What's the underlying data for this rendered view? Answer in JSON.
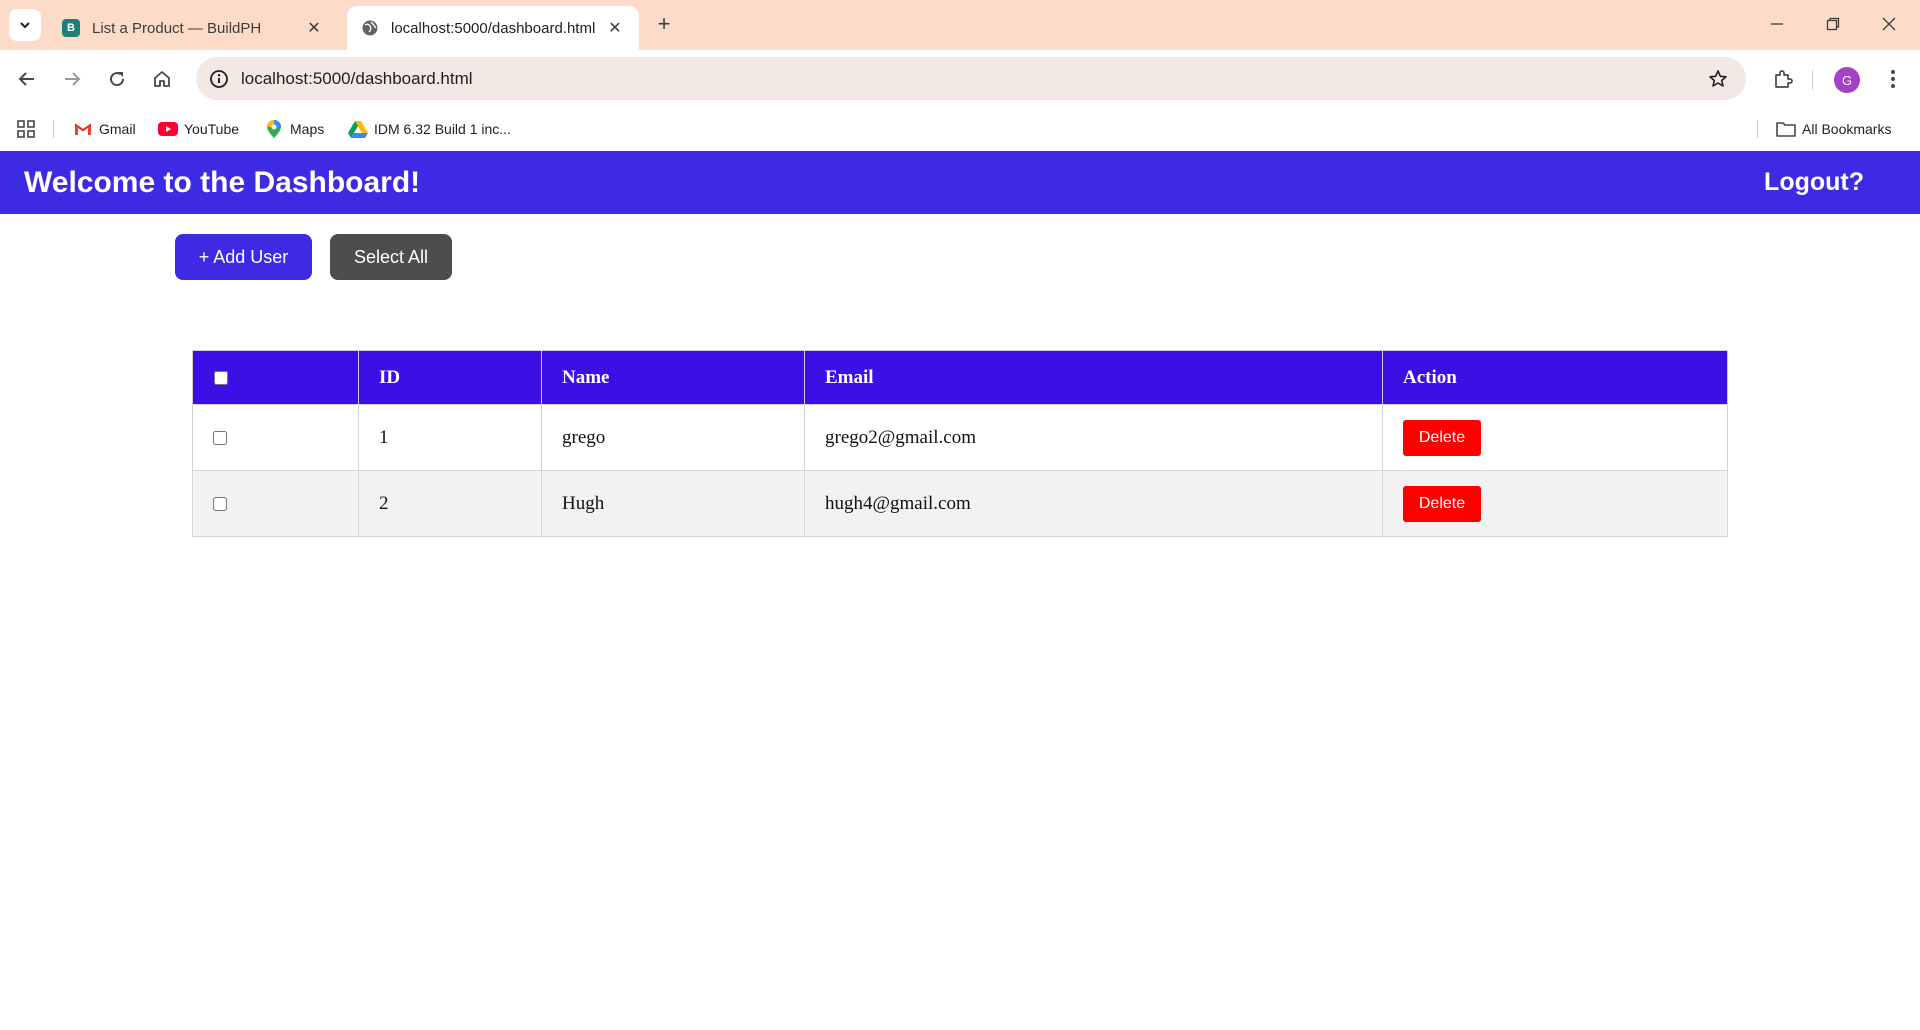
{
  "browser": {
    "tabs": [
      {
        "label": "List a Product — BuildPH",
        "favicon_letter": "B",
        "active": false
      },
      {
        "label": "localhost:5000/dashboard.html",
        "active": true
      }
    ],
    "address": "localhost:5000/dashboard.html",
    "profile_initial": "G",
    "bookmarks": [
      {
        "label": "Gmail",
        "icon": "gmail-icon"
      },
      {
        "label": "YouTube",
        "icon": "youtube-icon"
      },
      {
        "label": "Maps",
        "icon": "maps-icon"
      },
      {
        "label": "IDM 6.32 Build 1 inc...",
        "icon": "drive-icon"
      }
    ],
    "all_bookmarks_label": "All Bookmarks"
  },
  "header": {
    "title": "Welcome to the Dashboard!",
    "logout_label": "Logout?"
  },
  "actions": {
    "add_user_label": "+ Add User",
    "select_all_label": "Select All"
  },
  "table": {
    "columns": [
      "",
      "ID",
      "Name",
      "Email",
      "Action"
    ],
    "rows": [
      {
        "id": "1",
        "name": "grego",
        "email": "grego2@gmail.com",
        "action": "Delete"
      },
      {
        "id": "2",
        "name": "Hugh",
        "email": "hugh4@gmail.com",
        "action": "Delete"
      }
    ]
  },
  "colors": {
    "header_bg": "#3d2be3",
    "table_header_bg": "#3c0fe4",
    "select_all_bg": "#4d4d4d",
    "delete_bg": "#ff0000",
    "tabbar_bg": "#fddbc9"
  }
}
